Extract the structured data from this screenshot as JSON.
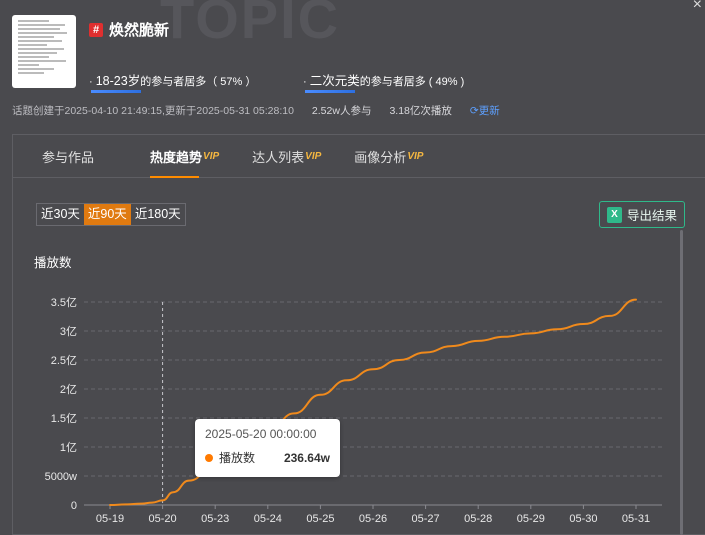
{
  "watermark": "TOPIC",
  "topic": {
    "badge": "#",
    "title": "焕然脆新"
  },
  "stats": [
    {
      "prefix": "· ",
      "highlight": "18-23岁",
      "text": "的参与者居多（ 57% ）"
    },
    {
      "prefix": "· ",
      "highlight": "二次元类",
      "text": "的参与者居多 ( 49% )"
    }
  ],
  "meta": {
    "created": "话题创建于2025-04-10 21:49:15,更新于2025-05-31 05:28:10",
    "participants": "2.52w人参与",
    "plays": "3.18亿次播放",
    "update_label": "更新",
    "update_icon": "refresh-icon"
  },
  "tabs": [
    {
      "label": "参与作品",
      "vip": ""
    },
    {
      "label": "热度趋势",
      "vip": "VIP"
    },
    {
      "label": "达人列表",
      "vip": "VIP"
    },
    {
      "label": "画像分析",
      "vip": "VIP"
    }
  ],
  "range": [
    "近30天",
    "近90天",
    "近180天"
  ],
  "export_label": "导出结果",
  "export_icon_letter": "X",
  "colors": {
    "line": "#f08a1c",
    "accent": "#e07a10",
    "export": "#2fb98a"
  },
  "chart_data": {
    "type": "line",
    "ylabel": "播放数",
    "categories": [
      "05-19",
      "05-20",
      "05-23",
      "05-24",
      "05-25",
      "05-26",
      "05-27",
      "05-28",
      "05-29",
      "05-30",
      "05-31"
    ],
    "y_ticks": [
      "0",
      "5000w",
      "1亿",
      "1.5亿",
      "2亿",
      "2.5亿",
      "3亿",
      "3.5亿"
    ],
    "ylim": [
      0,
      350000000
    ],
    "series": [
      {
        "name": "播放数",
        "x": [
          0,
          0.3,
          0.6,
          0.8,
          1.0,
          1.2,
          1.5,
          2.0,
          2.5,
          3.0,
          3.5,
          4.0,
          4.5,
          5.0,
          5.5,
          6.0,
          6.5,
          7.0,
          7.5,
          8.0,
          8.5,
          9.0,
          9.5,
          10.0
        ],
        "values": [
          0,
          1000000,
          2366400,
          4000000,
          8000000,
          22000000,
          42000000,
          68000000,
          95000000,
          125000000,
          158000000,
          190000000,
          215000000,
          234000000,
          250000000,
          263000000,
          274000000,
          283000000,
          290000000,
          296000000,
          303000000,
          312000000,
          326000000,
          354000000
        ]
      }
    ],
    "hover": {
      "category_index": 1,
      "date": "2025-05-20 00:00:00",
      "series": "播放数",
      "value": "236.64w"
    }
  }
}
